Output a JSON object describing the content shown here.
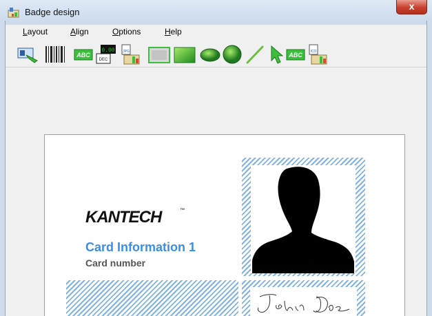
{
  "window": {
    "title": "Badge design",
    "close_label": "x"
  },
  "menu": [
    {
      "label": "Layout",
      "key": "L",
      "rest": "ayout"
    },
    {
      "label": "Align",
      "key": "A",
      "rest": "lign"
    },
    {
      "label": "Options",
      "key": "O",
      "rest": "ptions"
    },
    {
      "label": "Help",
      "key": "H",
      "rest": "elp"
    }
  ],
  "toolbar": {
    "tools": [
      "badge-properties-icon",
      "barcode-icon",
      "text-field-icon",
      "counter-icon",
      "photo-image-icon",
      "rectangle-icon",
      "filled-rectangle-icon",
      "ellipse-icon",
      "filled-circle-icon",
      "line-icon",
      "pointer-icon",
      "static-text-icon",
      "logo-image-icon"
    ],
    "text_glyph": "ABC",
    "counter_text": "0.00",
    "dec_text": "DEC",
    "jpg_text": "JPG",
    "ico_text": "ICO"
  },
  "badge": {
    "logo": "KANTECH",
    "logo_tm": "™",
    "card_info": "Card Information 1",
    "card_number": "Card number",
    "signature": "John Doe"
  },
  "colors": {
    "hatch_blue": "#7fb3e3",
    "card_info_blue": "#3a8ee6",
    "close_red": "#c7402e",
    "toolbar_green": "#3cbf3c"
  }
}
